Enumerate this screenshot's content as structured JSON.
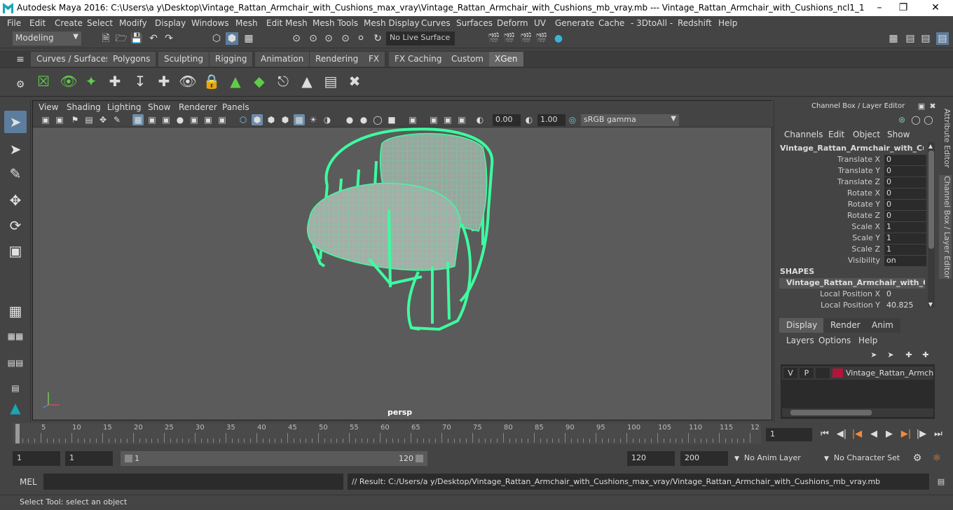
{
  "window": {
    "title": "Autodesk Maya 2016: C:\\Users\\a y\\Desktop\\Vintage_Rattan_Armchair_with_Cushions_max_vray\\Vintage_Rattan_Armchair_with_Cushions_mb_vray.mb  ---  Vintage_Rattan_Armchair_with_Cushions_ncl1_1"
  },
  "menubar": [
    "File",
    "Edit",
    "Create",
    "Select",
    "Modify",
    "Display",
    "Windows",
    "Mesh",
    "Edit Mesh",
    "Mesh Tools",
    "Mesh Display",
    "Curves",
    "Surfaces",
    "Deform",
    "UV",
    "Generate",
    "Cache",
    "- 3DtoAll -",
    "Redshift",
    "Help"
  ],
  "status": {
    "mode": "Modeling",
    "live_surface": "No Live Surface"
  },
  "shelf_tabs": [
    "Curves / Surfaces",
    "Polygons",
    "Sculpting",
    "Rigging",
    "Animation",
    "Rendering",
    "FX",
    "FX Caching",
    "Custom",
    "XGen"
  ],
  "shelf_active": "XGen",
  "viewport": {
    "menu": [
      "View",
      "Shading",
      "Lighting",
      "Show",
      "Renderer",
      "Panels"
    ],
    "exposure": "0.00",
    "gamma": "1.00",
    "colorspace": "sRGB gamma",
    "camera_label": "persp"
  },
  "channel_box": {
    "title": "Channel Box / Layer Editor",
    "menu": [
      "Channels",
      "Edit",
      "Object",
      "Show"
    ],
    "object_name": "Vintage_Rattan_Armchair_with_Cushi...",
    "attributes": [
      {
        "label": "Translate X",
        "value": "0"
      },
      {
        "label": "Translate Y",
        "value": "0"
      },
      {
        "label": "Translate Z",
        "value": "0"
      },
      {
        "label": "Rotate X",
        "value": "0"
      },
      {
        "label": "Rotate Y",
        "value": "0"
      },
      {
        "label": "Rotate Z",
        "value": "0"
      },
      {
        "label": "Scale X",
        "value": "1"
      },
      {
        "label": "Scale Y",
        "value": "1"
      },
      {
        "label": "Scale Z",
        "value": "1"
      },
      {
        "label": "Visibility",
        "value": "on"
      }
    ],
    "shapes_header": "SHAPES",
    "shape_name": "Vintage_Rattan_Armchair_with_Cus...",
    "shape_attributes": [
      {
        "label": "Local Position X",
        "value": "0"
      },
      {
        "label": "Local Position Y",
        "value": "40.825"
      }
    ]
  },
  "layer_editor": {
    "tabs": [
      "Display",
      "Render",
      "Anim"
    ],
    "menu": [
      "Layers",
      "Options",
      "Help"
    ],
    "layer": {
      "v": "V",
      "p": "P",
      "name": "Vintage_Rattan_Armchair",
      "color": "#b0163a"
    }
  },
  "side_tabs": [
    "Attribute Editor",
    "Channel Box / Layer Editor"
  ],
  "timeline": {
    "ticks": [
      "5",
      "10",
      "15",
      "20",
      "25",
      "30",
      "35",
      "40",
      "45",
      "50",
      "55",
      "60",
      "65",
      "70",
      "75",
      "80",
      "85",
      "90",
      "95",
      "100",
      "105",
      "110",
      "115",
      "12"
    ],
    "start_label": "1",
    "current_frame": "1"
  },
  "range": {
    "start": "1",
    "playback_start": "1",
    "slider_start": "1",
    "slider_end": "120",
    "playback_end": "120",
    "end": "200",
    "anim_layer": "No Anim Layer",
    "character_set": "No Character Set"
  },
  "mel": {
    "label": "MEL",
    "result": "// Result: C:/Users/a y/Desktop/Vintage_Rattan_Armchair_with_Cushions_max_vray/Vintage_Rattan_Armchair_with_Cushions_mb_vray.mb"
  },
  "help_line": "Select Tool: select an object",
  "colors": {
    "accent": "#5c7d9e",
    "wire": "#3dfca0"
  }
}
